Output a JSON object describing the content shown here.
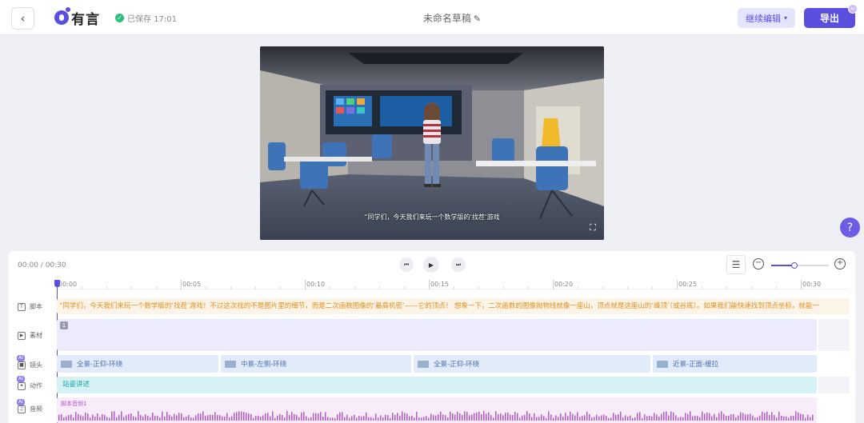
{
  "header": {
    "back_icon": "chevron-left-icon",
    "logo_text": "有言",
    "save_status": "已保存 17:01",
    "title": "未命名草稿",
    "continue_label": "继续编辑",
    "export_label": "导出",
    "vip_badge": "AI"
  },
  "preview": {
    "subtitle": "“同学们，今天我们来玩一个数学版的‘找茬’游戏",
    "fullscreen_icon": "fullscreen-icon"
  },
  "help": {
    "label": "?"
  },
  "timeline": {
    "time_display": "00:00 / 00:30",
    "zoom_level": 0.4,
    "ruler_ticks": [
      "00:00",
      "00:05",
      "00:10",
      "00:15",
      "00:20",
      "00:25",
      "00:30"
    ],
    "tracks": [
      {
        "name": "脚本",
        "icon": "T"
      },
      {
        "name": "素材",
        "icon": "▶"
      },
      {
        "name": "镜头",
        "icon": "■",
        "ai": "AI"
      },
      {
        "name": "动作",
        "icon": "✦",
        "ai": "AI"
      },
      {
        "name": "音频",
        "icon": "♫",
        "ai": "AI"
      }
    ],
    "script_text": "“同学们，今天我们来玩一个数学版的‘找茬’游戏！不过这次找的不是图片里的细节，而是二次函数图像的‘最高机密’——它的顶点！ 想象一下，二次函数的图像抛物线就像一座山，顶点就是这座山的‘峰顶’（或谷底）。如果我们能快速找到顶点坐标，就能一",
    "material_index": "1",
    "shots": [
      "全景-正仰-环绕",
      "中景-左侧-环绕",
      "全景-正仰-环绕",
      "近景-正面-缓拉"
    ],
    "action_label": "站姿讲述",
    "audio_label": "脚本音频1"
  },
  "colors": {
    "accent": "#5a4ee0",
    "script": "#e08d1c",
    "shot": "#4a6fb0",
    "action": "#1aa3ad",
    "audio": "#b25cc6"
  }
}
